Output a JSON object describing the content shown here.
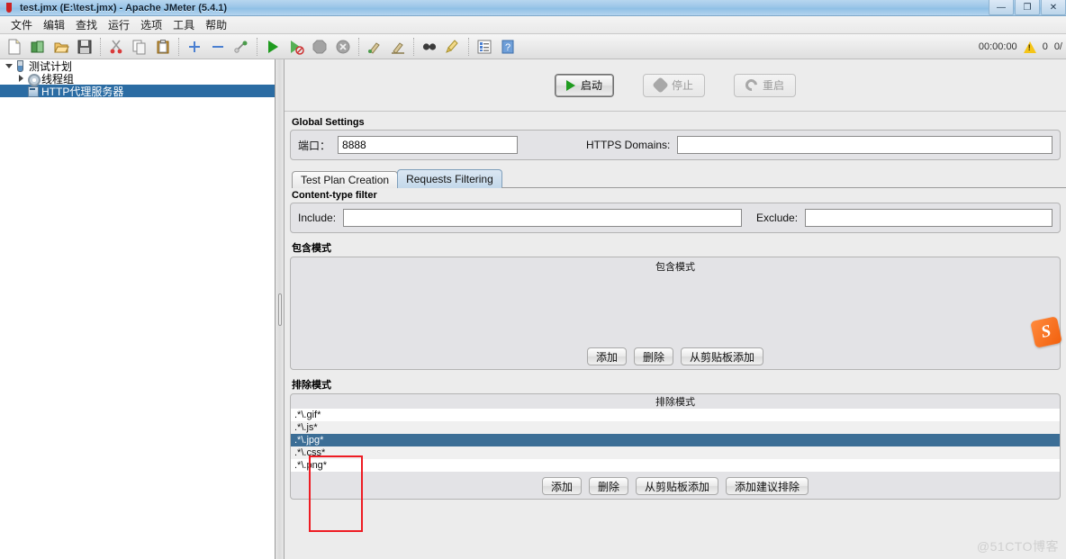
{
  "window": {
    "title": "test.jmx (E:\\test.jmx) - Apache JMeter (5.4.1)",
    "icon": "jmeter-flask-icon",
    "buttons": {
      "minimize": "—",
      "maximize": "❐",
      "close": "✕"
    }
  },
  "menu": {
    "items": [
      {
        "label": "文件"
      },
      {
        "label": "编辑"
      },
      {
        "label": "查找"
      },
      {
        "label": "运行"
      },
      {
        "label": "选项"
      },
      {
        "label": "工具"
      },
      {
        "label": "帮助"
      }
    ]
  },
  "toolbar": {
    "buttons": [
      {
        "name": "new-icon"
      },
      {
        "name": "templates-icon"
      },
      {
        "name": "open-icon"
      },
      {
        "name": "save-icon"
      },
      {
        "name": "cut-icon"
      },
      {
        "name": "copy-icon"
      },
      {
        "name": "paste-icon"
      },
      {
        "name": "expand-icon"
      },
      {
        "name": "collapse-icon"
      },
      {
        "name": "toggle-icon"
      },
      {
        "name": "start-icon"
      },
      {
        "name": "start-no-pauses-icon"
      },
      {
        "name": "stop-icon"
      },
      {
        "name": "shutdown-icon"
      },
      {
        "name": "clear-icon"
      },
      {
        "name": "clear-all-icon"
      },
      {
        "name": "search-icon"
      },
      {
        "name": "search-reset-icon"
      },
      {
        "name": "function-helper-icon"
      },
      {
        "name": "help-icon"
      }
    ],
    "status": {
      "elapsed": "00:00:00",
      "warning_count": "0",
      "threads": "0/"
    }
  },
  "tree": {
    "nodes": [
      {
        "label": "测试计划",
        "icon": "test-plan-icon",
        "expanded": true,
        "depth": 0,
        "selected": false
      },
      {
        "label": "线程组",
        "icon": "thread-group-icon",
        "expanded": false,
        "depth": 1,
        "selected": false
      },
      {
        "label": "HTTP代理服务器",
        "icon": "http-proxy-icon",
        "expanded": null,
        "depth": 1,
        "selected": true
      }
    ]
  },
  "controls": {
    "start": "启动",
    "stop": "停止",
    "restart": "重启"
  },
  "global_settings": {
    "title": "Global Settings",
    "port_label": "端口：",
    "port_value": "8888",
    "https_domains_label": "HTTPS Domains:",
    "https_domains_value": ""
  },
  "tabs": [
    {
      "label": "Test Plan Creation",
      "active": false
    },
    {
      "label": "Requests Filtering",
      "active": true
    }
  ],
  "content_type_filter": {
    "title": "Content-type filter",
    "include_label": "Include:",
    "include_value": "",
    "exclude_label": "Exclude:",
    "exclude_value": ""
  },
  "include_patterns": {
    "title": "包含模式",
    "column_header": "包含模式",
    "rows": [],
    "buttons": [
      {
        "label": "添加"
      },
      {
        "label": "删除"
      },
      {
        "label": "从剪贴板添加"
      }
    ]
  },
  "exclude_patterns": {
    "title": "排除模式",
    "column_header": "排除模式",
    "rows": [
      {
        "value": ".*\\.gif*",
        "selected": false
      },
      {
        "value": ".*\\.js*",
        "selected": false
      },
      {
        "value": ".*\\.jpg*",
        "selected": true
      },
      {
        "value": ".*\\.css*",
        "selected": false
      },
      {
        "value": ".*\\.png*",
        "selected": false
      }
    ],
    "buttons": [
      {
        "label": "添加"
      },
      {
        "label": "删除"
      },
      {
        "label": "从剪贴板添加"
      },
      {
        "label": "添加建议排除"
      }
    ]
  },
  "overlays": {
    "sogou_logo": "S",
    "watermark": "@51CTO博客",
    "highlight_color": "#ee1c23"
  }
}
